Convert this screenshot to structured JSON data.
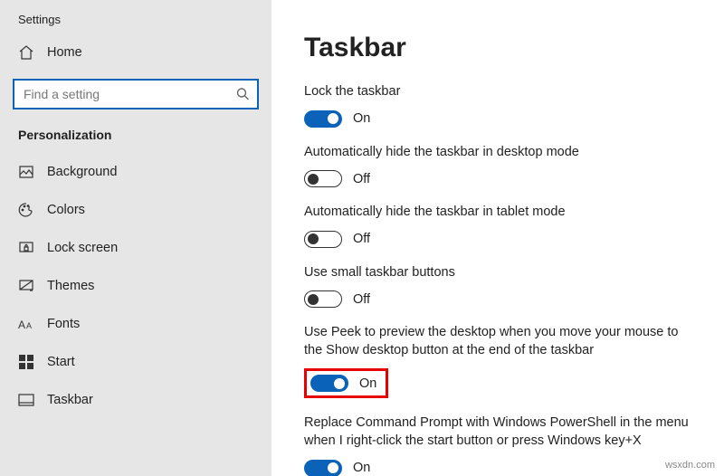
{
  "window_title": "Settings",
  "home_label": "Home",
  "search_placeholder": "Find a setting",
  "section_label": "Personalization",
  "nav": [
    {
      "id": "background",
      "label": "Background"
    },
    {
      "id": "colors",
      "label": "Colors"
    },
    {
      "id": "lockscreen",
      "label": "Lock screen"
    },
    {
      "id": "themes",
      "label": "Themes"
    },
    {
      "id": "fonts",
      "label": "Fonts"
    },
    {
      "id": "start",
      "label": "Start"
    },
    {
      "id": "taskbar",
      "label": "Taskbar"
    }
  ],
  "page_title": "Taskbar",
  "settings": [
    {
      "label": "Lock the taskbar",
      "on": true,
      "state": "On"
    },
    {
      "label": "Automatically hide the taskbar in desktop mode",
      "on": false,
      "state": "Off"
    },
    {
      "label": "Automatically hide the taskbar in tablet mode",
      "on": false,
      "state": "Off"
    },
    {
      "label": "Use small taskbar buttons",
      "on": false,
      "state": "Off"
    },
    {
      "label": "Use Peek to preview the desktop when you move your mouse to the Show desktop button at the end of the taskbar",
      "on": true,
      "state": "On",
      "highlight": true
    },
    {
      "label": "Replace Command Prompt with Windows PowerShell in the menu when I right-click the start button or press Windows key+X",
      "on": true,
      "state": "On"
    }
  ],
  "watermark": "wsxdn.com",
  "colors": {
    "accent": "#0a63b8",
    "highlight": "#e60000"
  }
}
